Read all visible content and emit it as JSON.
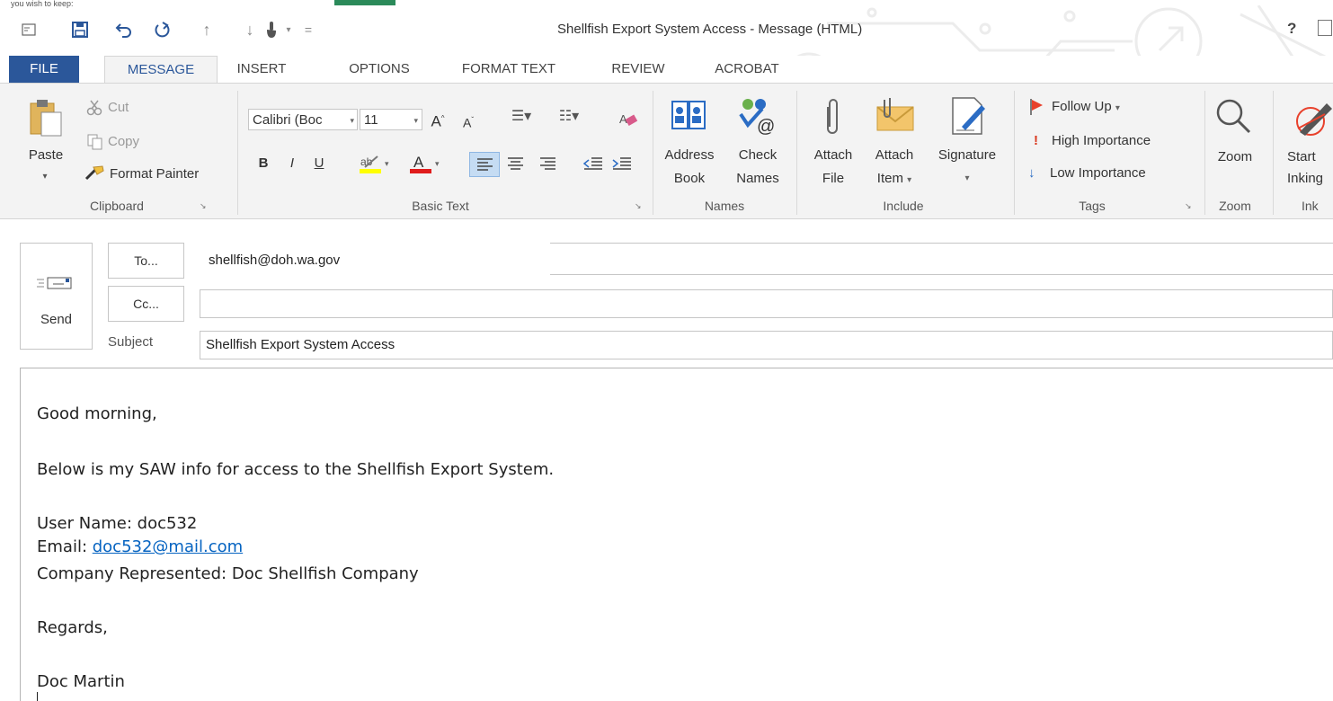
{
  "window": {
    "title": "Shellfish Export System Access - Message (HTML)",
    "help": "?",
    "top_fragment": "you wish to keep:"
  },
  "tabs": [
    {
      "label": "FILE"
    },
    {
      "label": "MESSAGE"
    },
    {
      "label": "INSERT"
    },
    {
      "label": "OPTIONS"
    },
    {
      "label": "FORMAT TEXT"
    },
    {
      "label": "REVIEW"
    },
    {
      "label": "ACROBAT"
    }
  ],
  "ribbon": {
    "clipboard": {
      "paste": "Paste",
      "cut": "Cut",
      "copy": "Copy",
      "format_painter": "Format Painter",
      "group": "Clipboard"
    },
    "basic_text": {
      "font_name": "Calibri (Boc",
      "font_size": "11",
      "bold": "B",
      "italic": "I",
      "underline": "U",
      "group": "Basic Text"
    },
    "names": {
      "address_book_1": "Address",
      "address_book_2": "Book",
      "check_names_1": "Check",
      "check_names_2": "Names",
      "group": "Names"
    },
    "include": {
      "attach_file_1": "Attach",
      "attach_file_2": "File",
      "attach_item_1": "Attach",
      "attach_item_2": "Item",
      "signature": "Signature",
      "group": "Include"
    },
    "tags": {
      "follow_up": "Follow Up",
      "high": "High Importance",
      "low": "Low Importance",
      "group": "Tags"
    },
    "zoom": {
      "zoom": "Zoom",
      "group": "Zoom"
    },
    "ink": {
      "start_1": "Start",
      "start_2": "Inking",
      "group": "Ink"
    }
  },
  "header": {
    "send": "Send",
    "to_button": "To...",
    "to_value": "shellfish@doh.wa.gov",
    "cc_button": "Cc...",
    "cc_value": "",
    "subject_label": "Subject",
    "subject_value": "Shellfish Export System Access"
  },
  "body": {
    "greeting": "Good morning,",
    "intro": "Below is my SAW info for access to the Shellfish Export System.",
    "user_name": "User Name: doc532",
    "email_label": "Email: ",
    "email_link": "doc532@mail.com",
    "company": "Company Represented: Doc Shellfish Company",
    "closing": "Regards,",
    "signature": "Doc Martin"
  },
  "colors": {
    "accent": "#2b579a",
    "ribbon_bg": "#f3f3f3",
    "link": "#0563c1",
    "follow_up_flag": "#e8412c",
    "high_importance": "#d9381e",
    "low_importance": "#2b6cc4"
  }
}
